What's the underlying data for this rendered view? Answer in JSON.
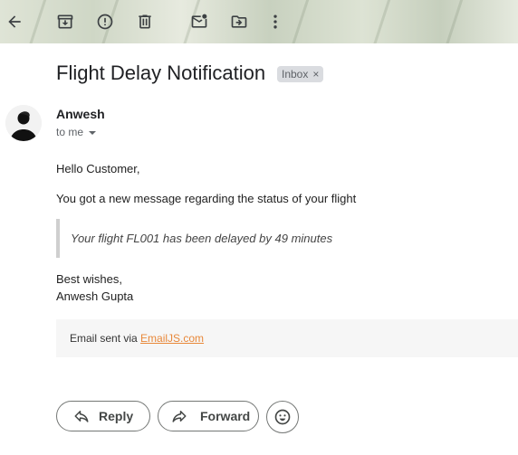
{
  "email": {
    "subject": "Flight Delay Notification",
    "label": "Inbox",
    "label_remove": "×",
    "sender": "Anwesh",
    "recipient": "to me",
    "greeting": "Hello Customer,",
    "intro": "You got a new message regarding the status of your flight",
    "quote": "Your flight FL001 has been delayed by 49 minutes",
    "signoff": "Best wishes,",
    "signature": "Anwesh Gupta",
    "footer_prefix": "Email sent via ",
    "footer_link": "EmailJS.com"
  },
  "actions": {
    "reply": "Reply",
    "forward": "Forward"
  },
  "toolbar_icons": [
    "back-icon",
    "archive-icon",
    "report-spam-icon",
    "delete-icon",
    "mark-unread-icon",
    "move-to-icon",
    "more-icon"
  ]
}
